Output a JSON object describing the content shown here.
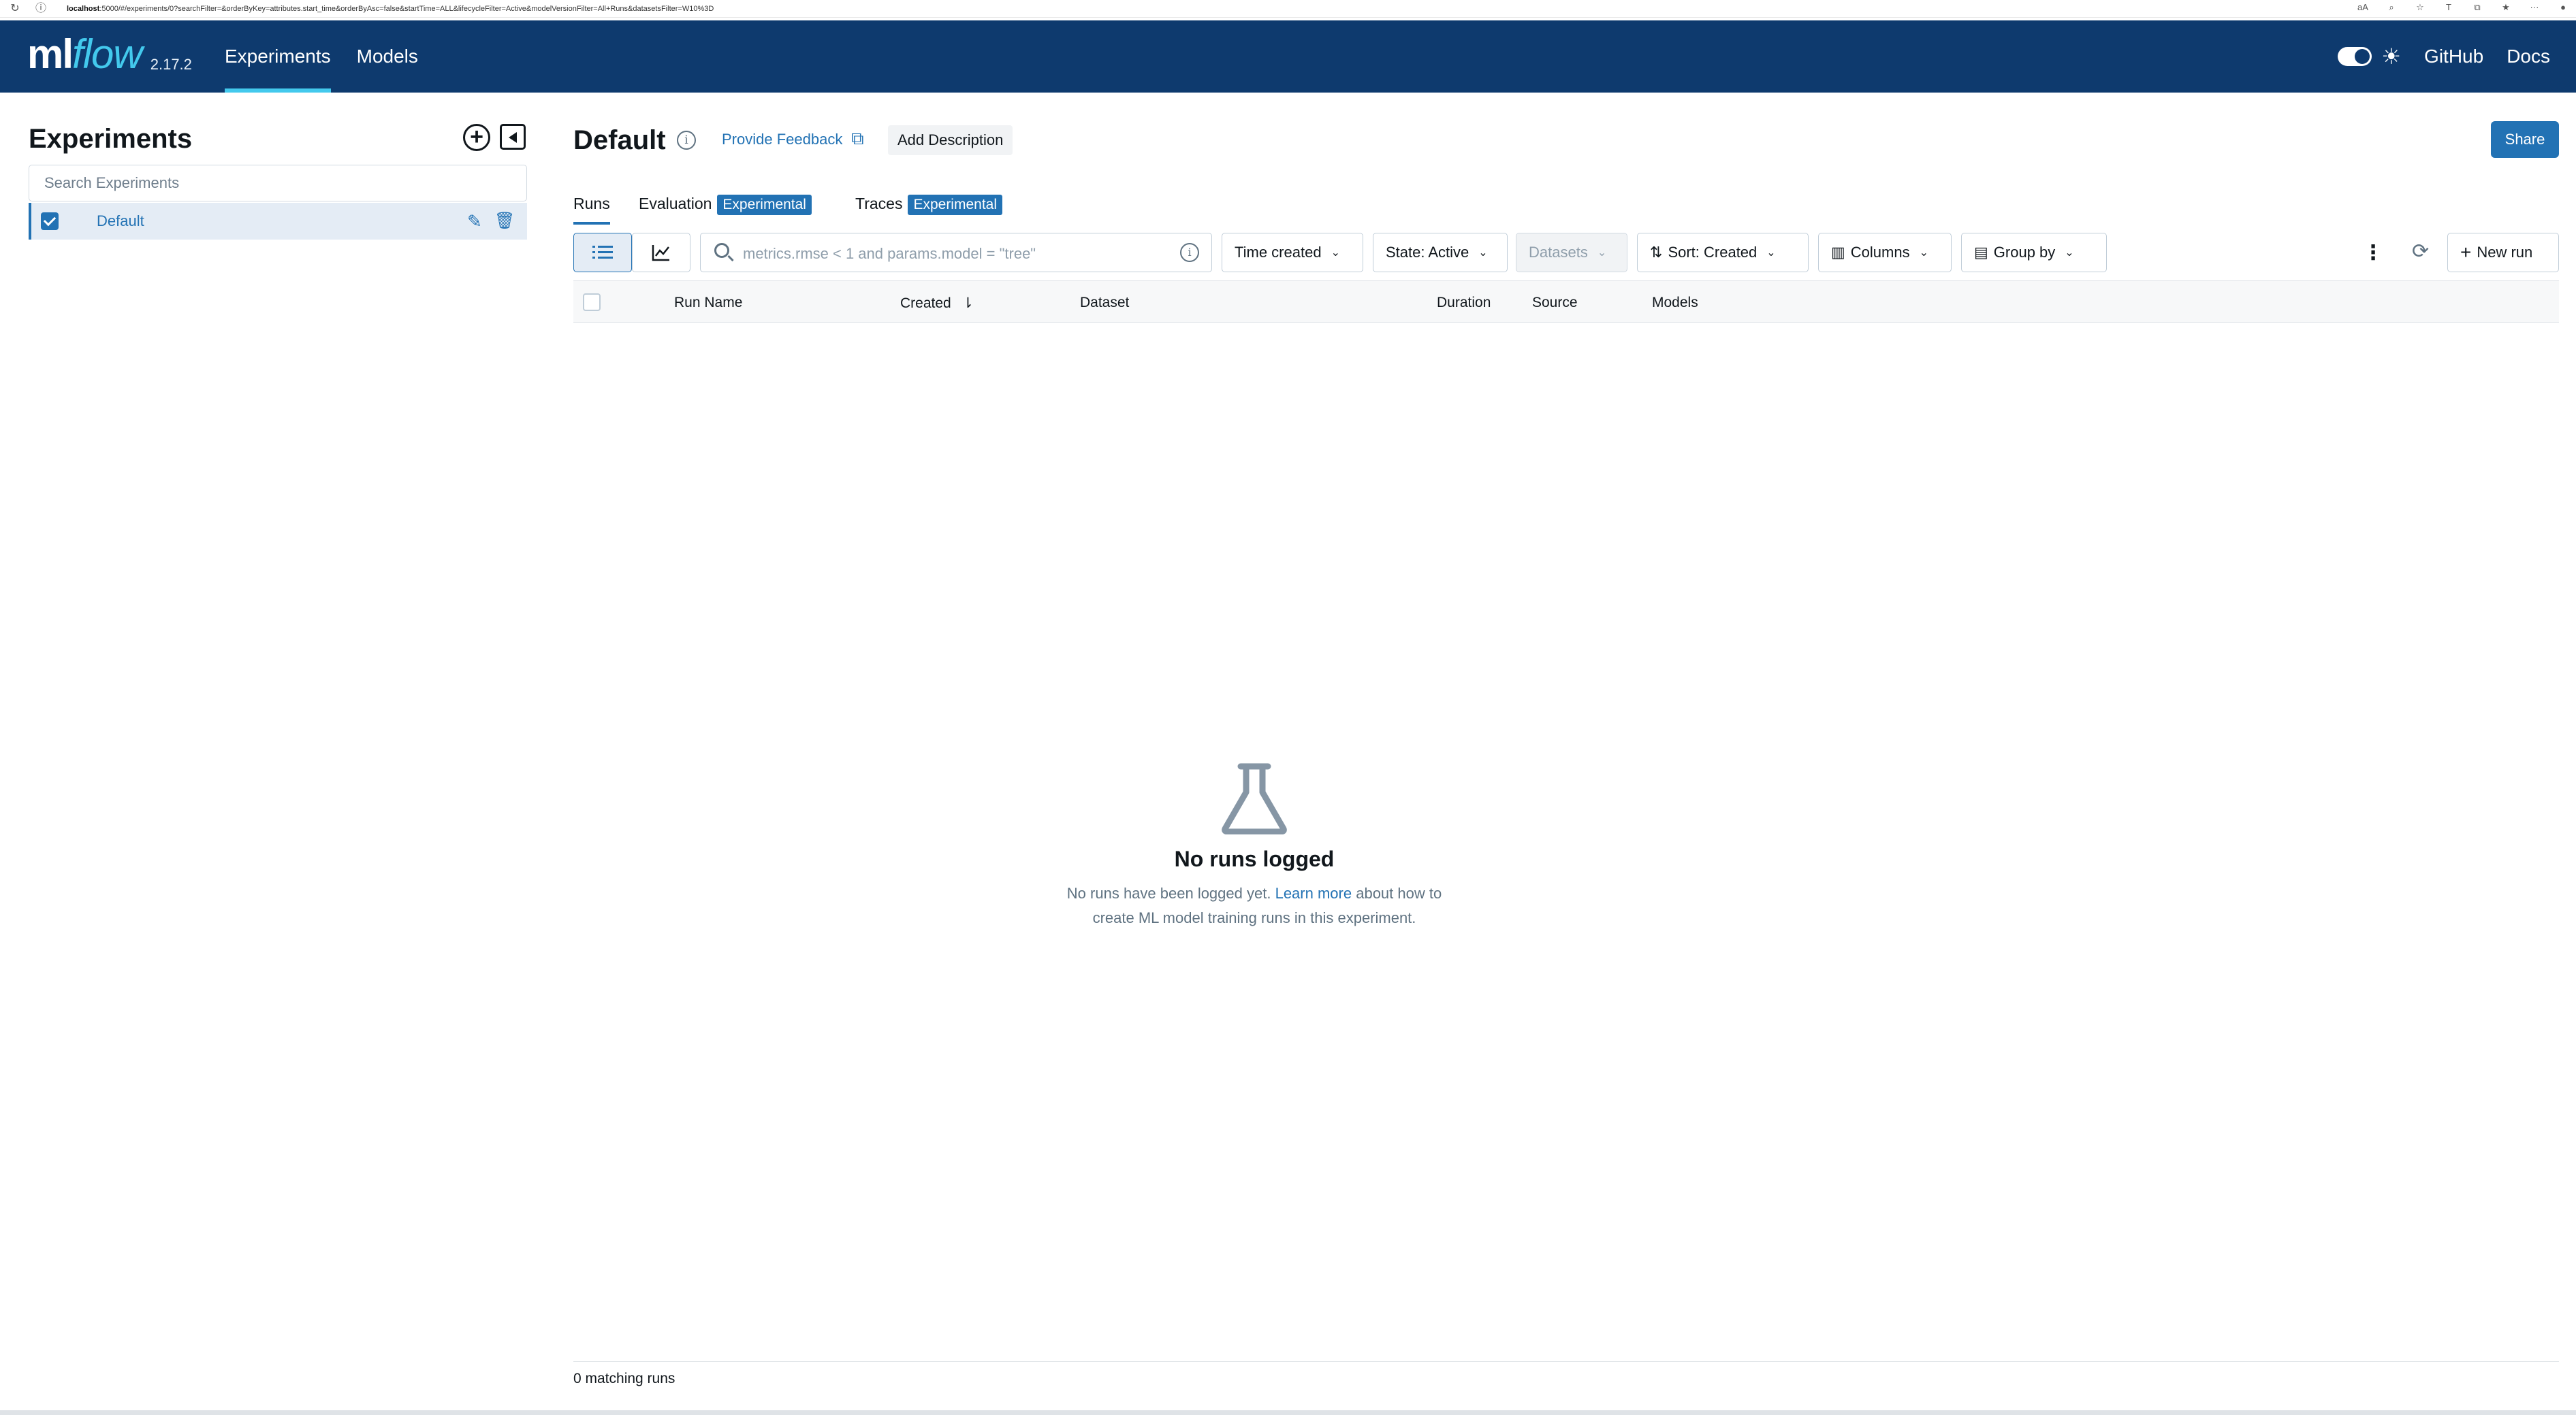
{
  "browser": {
    "url_host": "localhost",
    "url_rest": ":5000/#/experiments/0?searchFilter=&orderByKey=attributes.start_time&orderByAsc=false&startTime=ALL&lifecycleFilter=Active&modelVersionFilter=All+Runs&datasetsFilter=W10%3D"
  },
  "header": {
    "logo_ml": "ml",
    "logo_flow": "flow",
    "version": "2.17.2",
    "nav": [
      "Experiments",
      "Models"
    ],
    "links": {
      "github": "GitHub",
      "docs": "Docs"
    }
  },
  "sidebar": {
    "title": "Experiments",
    "search_placeholder": "Search Experiments",
    "items": [
      {
        "label": "Default",
        "selected": true
      }
    ]
  },
  "main": {
    "title": "Default",
    "feedback": "Provide Feedback",
    "add_description": "Add Description",
    "share": "Share",
    "tabs": [
      {
        "label": "Runs",
        "active": true
      },
      {
        "label": "Evaluation",
        "badge": "Experimental"
      },
      {
        "label": "Traces",
        "badge": "Experimental"
      }
    ],
    "toolbar": {
      "search_placeholder": "metrics.rmse < 1 and params.model = \"tree\"",
      "time_created": "Time created",
      "state": "State: Active",
      "datasets": "Datasets",
      "sort": "Sort: Created",
      "columns": "Columns",
      "group_by": "Group by",
      "new_run": "New run"
    },
    "columns": [
      "Run Name",
      "Created",
      "Dataset",
      "Duration",
      "Source",
      "Models"
    ],
    "empty": {
      "title": "No runs logged",
      "desc_before": "No runs have been logged yet.",
      "learn_more": "Learn more",
      "desc_after": "about how to",
      "desc_line2": "create ML model training runs in this experiment."
    },
    "footer": "0 matching runs"
  },
  "colors": {
    "header_bg": "#0e3a6e",
    "accent": "#2272b4",
    "logo_flow": "#43c9ed"
  }
}
